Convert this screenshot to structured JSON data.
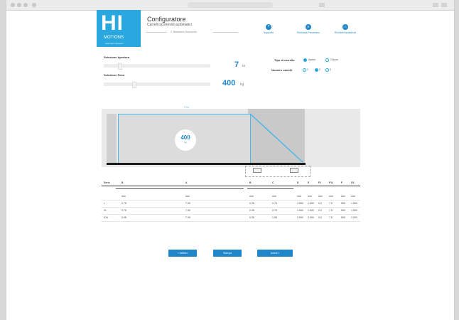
{
  "app": {
    "logo_text": "HI",
    "logo_brand": "MOTIONS",
    "logo_tag": "Automatic Systems",
    "title": "Configuratore",
    "subtitle": "Carrelli scorrevoli automatici",
    "steps": [
      "",
      "2. Selezione Scorrevole",
      ""
    ],
    "language": ""
  },
  "toolbar": [
    {
      "label": "Supporto",
      "icon": "question-icon"
    },
    {
      "label": "Richiesta Preventivo",
      "icon": "document-icon"
    },
    {
      "label": "Richiedi Assistenza",
      "icon": "headset-icon"
    }
  ],
  "form": {
    "opening_label": "Selezione Apertura",
    "opening_value": "7",
    "opening_unit": "m",
    "weight_label": "Selezione Peso",
    "weight_value": "400",
    "weight_unit": "kg",
    "type_label": "Tipo di carrello",
    "type_options": [
      "Aperto",
      "Chiuso"
    ],
    "type_selected": 0,
    "count_label": "Numero carrelli",
    "count_options": [
      "1",
      "2",
      "3"
    ],
    "count_selected": 1
  },
  "diagram": {
    "width_label": "7 m",
    "weight_value": "400",
    "weight_unit": "kg"
  },
  "table": {
    "headers": [
      "Serie",
      "B",
      "A",
      "B",
      "C",
      "D",
      "E",
      "F1",
      "F1L",
      "F",
      "G1"
    ],
    "units": [
      "",
      "mm",
      "mm",
      "mm",
      "mm",
      "mm",
      "mm",
      "mm",
      "mm",
      "mm",
      "mm"
    ],
    "rows": [
      [
        "L",
        "0.75",
        "7.50",
        "0.35",
        "0.75",
        "1.500",
        "1.500",
        "0.0",
        "7.5",
        "500",
        "1.500"
      ],
      [
        "XL",
        "0.75",
        "7.50",
        "0.35",
        "0.75",
        "1.500",
        "1.500",
        "0.0",
        "7.5",
        "500",
        "1.500"
      ],
      [
        "XXL",
        "0.95",
        "7.90",
        "0.35",
        "1.05",
        "2.000",
        "2.000",
        "0.0",
        "7.5",
        "500",
        "2.000"
      ]
    ]
  },
  "buttons": {
    "back": "« Indietro",
    "print": "Stampa",
    "next": "Avanti »"
  }
}
